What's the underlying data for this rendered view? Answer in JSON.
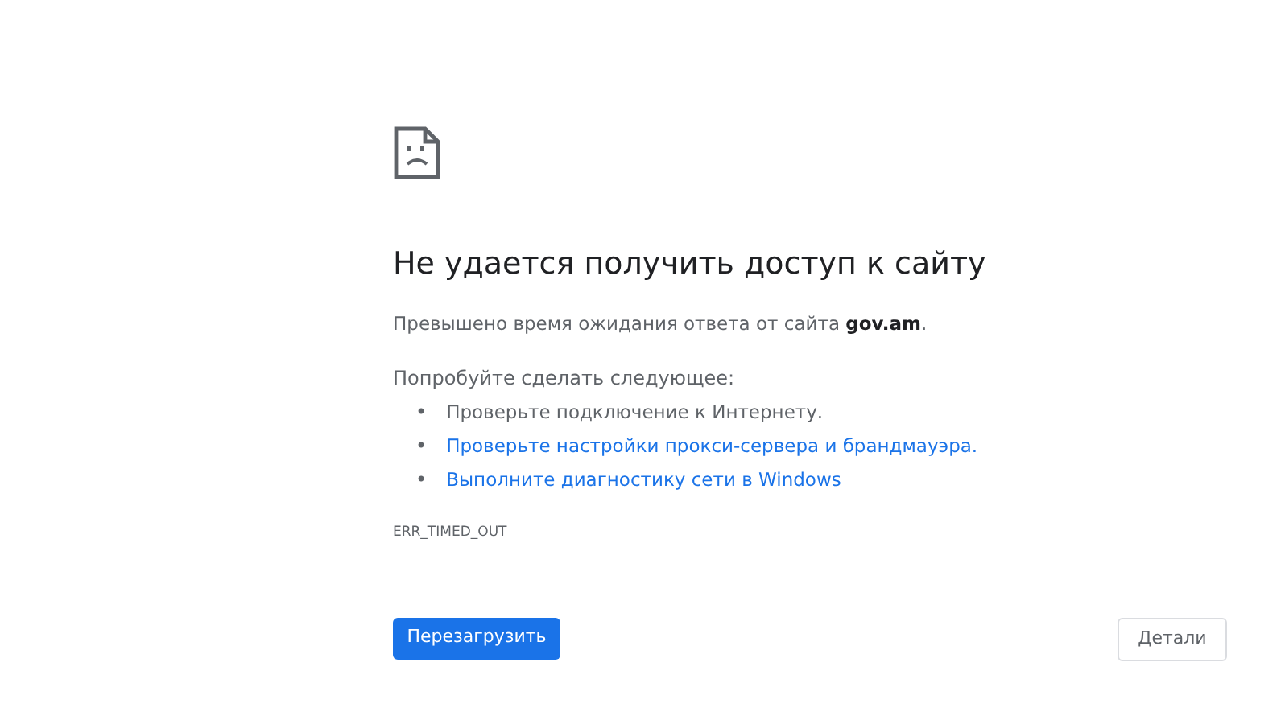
{
  "heading": "Не удается получить доступ к сайту",
  "summary": "Превышено время ожидания ответа от сайта **gov.am**.",
  "suggestions_title": "Попробуйте сделать следующее:",
  "suggestions": [
    {
      "kind": "text",
      "bullet": "•",
      "text": "Проверьте подключение к Интернету."
    },
    {
      "kind": "link",
      "bullet": "•",
      "text": "Проверьте настройки прокси-сервера и брандмауэра."
    },
    {
      "kind": "link",
      "bullet": "•",
      "text": "Выполните диагностику сети в Windows"
    }
  ],
  "error_code": "ERR_TIMED_OUT",
  "buttons": [
    {
      "kind": "primary",
      "label": "Перезагрузить"
    },
    {
      "kind": "secondary",
      "label": "Детали"
    }
  ]
}
